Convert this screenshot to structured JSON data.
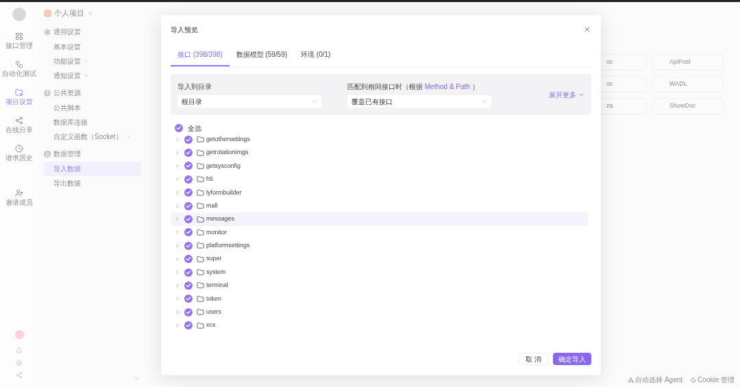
{
  "rail": {
    "items": [
      {
        "label": "接口管理",
        "selected": false
      },
      {
        "label": "自动化测试",
        "selected": false
      },
      {
        "label": "项目设置",
        "selected": true
      },
      {
        "label": "在线分享",
        "selected": false
      },
      {
        "label": "请求历史",
        "selected": false
      },
      {
        "label": "邀请成员",
        "selected": false
      }
    ]
  },
  "sidebar": {
    "project": "个人项目",
    "groups": [
      {
        "title": "通用设置",
        "items": [
          {
            "label": "基本设置",
            "selected": false,
            "has_submenu": false
          },
          {
            "label": "功能设置",
            "selected": false,
            "has_submenu": true
          },
          {
            "label": "通知设置",
            "selected": false,
            "has_submenu": true
          }
        ]
      },
      {
        "title": "公共资源",
        "items": [
          {
            "label": "公共脚本",
            "selected": false,
            "has_submenu": false
          },
          {
            "label": "数据库连接",
            "selected": false,
            "has_submenu": false
          },
          {
            "label": "自定义函数（Socket）",
            "selected": false,
            "has_submenu": true
          }
        ]
      },
      {
        "title": "数据管理",
        "items": [
          {
            "label": "导入数据",
            "selected": true,
            "has_submenu": false
          },
          {
            "label": "导出数据",
            "selected": false,
            "has_submenu": false
          }
        ]
      }
    ]
  },
  "background_cards": [
    {
      "label": "oc",
      "label2": "ApiPost"
    },
    {
      "label": "oc",
      "label2": "WADL"
    },
    {
      "label": "za",
      "label2": "ShowDoc"
    }
  ],
  "status_bar": {
    "agent": "自动选择 Agent",
    "cookie": "Cookie 管理"
  },
  "dialog": {
    "title": "导入预览",
    "tabs": [
      {
        "label": "接口 (398/398)",
        "selected": true
      },
      {
        "label": "数据模型 (59/59)",
        "selected": false
      },
      {
        "label": "环境 (0/1)",
        "selected": false
      }
    ],
    "target_label": "导入到目录",
    "target_value": "根目录",
    "match_label": "匹配到相同接口时（根据 ",
    "match_link": "Method & Path",
    "match_tail": " ）",
    "match_value": "覆盖已有接口",
    "expand": "展开更多",
    "select_all": {
      "label": "全选",
      "checked": true
    },
    "tree": [
      {
        "name": "getothersettings",
        "checked": true,
        "highlighted": false
      },
      {
        "name": "getrotationimgs",
        "checked": true,
        "highlighted": false
      },
      {
        "name": "getsysconfig",
        "checked": true,
        "highlighted": false
      },
      {
        "name": "h5",
        "checked": true,
        "highlighted": false
      },
      {
        "name": "lyformbuilder",
        "checked": true,
        "highlighted": false
      },
      {
        "name": "mall",
        "checked": true,
        "highlighted": false
      },
      {
        "name": "messages",
        "checked": true,
        "highlighted": true
      },
      {
        "name": "monitor",
        "checked": true,
        "highlighted": false
      },
      {
        "name": "platformsettings",
        "checked": true,
        "highlighted": false
      },
      {
        "name": "super",
        "checked": true,
        "highlighted": false
      },
      {
        "name": "system",
        "checked": true,
        "highlighted": false
      },
      {
        "name": "terminal",
        "checked": true,
        "highlighted": false
      },
      {
        "name": "token",
        "checked": true,
        "highlighted": false
      },
      {
        "name": "users",
        "checked": true,
        "highlighted": false
      },
      {
        "name": "xcx",
        "checked": true,
        "highlighted": false
      }
    ],
    "cancel": "取 消",
    "confirm": "确定导入"
  }
}
